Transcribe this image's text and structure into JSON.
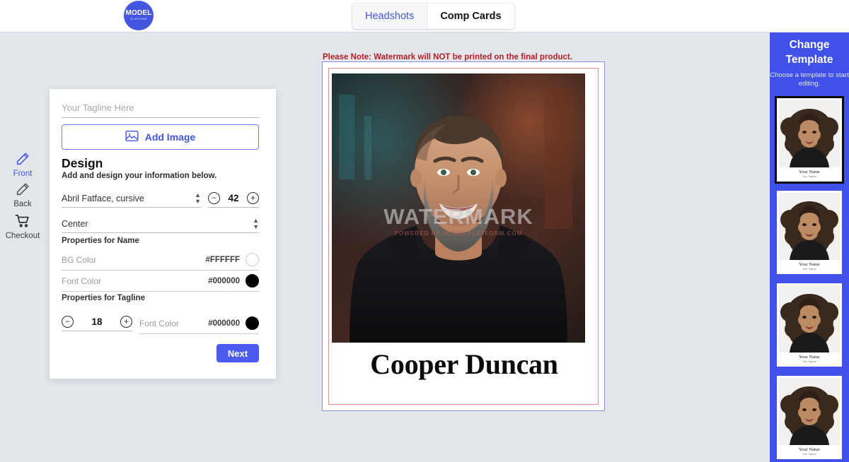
{
  "header": {
    "logo": {
      "main": "MODEL",
      "sub": "PLATFORM",
      "icon": "model-platform-logo",
      "color": "#4455e0"
    },
    "tabs": [
      {
        "label": "Headshots",
        "active": false
      },
      {
        "label": "Comp Cards",
        "active": true
      }
    ]
  },
  "left_rail": {
    "items": [
      {
        "label": "Front",
        "icon": "pencil-icon",
        "active": true
      },
      {
        "label": "Back",
        "icon": "pencil-icon",
        "active": false
      },
      {
        "label": "Checkout",
        "icon": "shopping-cart-icon",
        "active": false
      }
    ]
  },
  "editor": {
    "tagline": {
      "value": "",
      "placeholder": "Your Tagline Here"
    },
    "add_image_label": "Add Image",
    "add_image_icon": "image-icon",
    "design_title": "Design",
    "design_subtitle": "Add and design your information below.",
    "font_family": "Abril Fatface, cursive",
    "name_font_size": "42",
    "alignment": "Center",
    "properties_name_heading": "Properties for Name",
    "properties_tagline_heading": "Properties for Tagline",
    "name_bg_color": {
      "label": "BG Color",
      "hex": "#FFFFFF"
    },
    "name_font_color": {
      "label": "Font Color",
      "hex": "#000000"
    },
    "tagline_font_size": "18",
    "tagline_font_color": {
      "label": "Font Color",
      "hex": "#000000"
    },
    "next_label": "Next",
    "decrement_glyph": "−",
    "increment_glyph": "+"
  },
  "canvas": {
    "note": "Please Note: Watermark will NOT be printed on the final product.",
    "note_color": "#b22026",
    "card_border_outer": "#8c8ce0",
    "card_border_inner": "#e98c8c",
    "watermark_main": "WATERMARK",
    "watermark_sub": "POWERED BY MODELPLATFORM.COM",
    "name": "Cooper Duncan"
  },
  "template_rail": {
    "title_line1": "Change",
    "title_line2": "Template",
    "subtitle": "Choose a template to start editing.",
    "background": "#3f51e8",
    "templates": [
      {
        "name": "Your Name",
        "tagline": "Your Tagline",
        "selected": true
      },
      {
        "name": "Your Name",
        "tagline": "Your Tagline",
        "selected": false
      },
      {
        "name": "Your Name",
        "tagline": "Your Tagline",
        "selected": false
      },
      {
        "name": "Your Name",
        "tagline": "Your Tagline",
        "selected": false
      }
    ]
  }
}
